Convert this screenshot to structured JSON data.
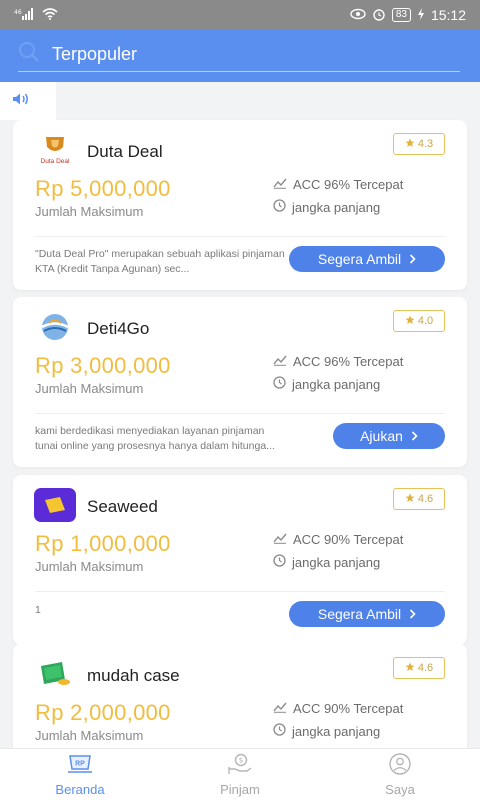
{
  "status_bar": {
    "signal": "46",
    "battery": "83",
    "time": "15:12"
  },
  "header": {
    "title": "Terpopuler"
  },
  "cards": [
    {
      "name": "Duta Deal",
      "logo_text": "Duta Deal",
      "rating": "4.3",
      "amount": "Rp 5,000,000",
      "amount_label": "Jumlah Maksimum",
      "acc": "ACC 96% Tercepat",
      "term": "jangka panjang",
      "desc": "\"Duta Deal Pro\" merupakan sebuah aplikasi pinjaman KTA (Kredit Tanpa Agunan) sec...",
      "button": "Segera Ambil"
    },
    {
      "name": "Deti4Go",
      "rating": "4.0",
      "amount": "Rp 3,000,000",
      "amount_label": "Jumlah Maksimum",
      "acc": "ACC 96% Tercepat",
      "term": "jangka panjang",
      "desc": " kami berdedikasi menyediakan layanan pinjaman tunai online yang prosesnya hanya dalam hitunga...",
      "button": "Ajukan"
    },
    {
      "name": "Seaweed",
      "rating": "4.6",
      "amount": "Rp 1,000,000",
      "amount_label": "Jumlah Maksimum",
      "acc": "ACC 90% Tercepat",
      "term": "jangka panjang",
      "desc": "1",
      "button": "Segera Ambil"
    },
    {
      "name": "mudah case",
      "rating": "4.6",
      "amount": "Rp 2,000,000",
      "amount_label": "Jumlah Maksimum",
      "acc": "ACC 90% Tercepat",
      "term": "jangka panjang"
    }
  ],
  "nav": {
    "home": "Beranda",
    "home_icon_text": "RP",
    "loan": "Pinjam",
    "profile": "Saya"
  },
  "colors": {
    "primary": "#5a8fef",
    "button": "#4e82e8",
    "amount": "#f0bd3f",
    "rating": "#c9a64b"
  }
}
